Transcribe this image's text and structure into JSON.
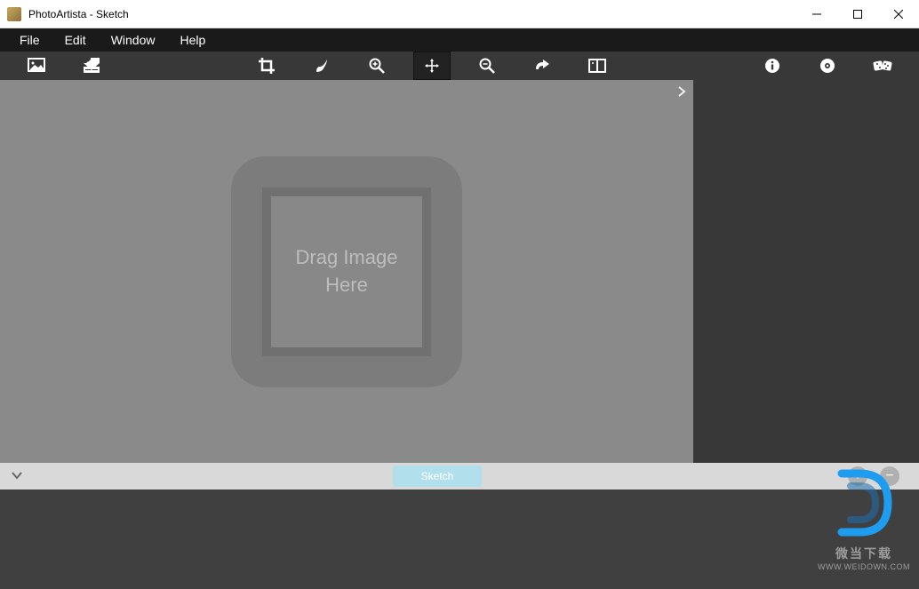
{
  "window": {
    "title": "PhotoArtista - Sketch"
  },
  "menu": {
    "file": "File",
    "edit": "Edit",
    "window": "Window",
    "help": "Help"
  },
  "toolbar": {
    "open": "open-image",
    "save": "save-image",
    "crop": "crop",
    "brush": "brush",
    "zoom_in": "zoom-in",
    "pan": "pan",
    "zoom_out": "zoom-out",
    "redo": "redo",
    "compare": "compare",
    "info": "info",
    "settings": "settings",
    "random": "random"
  },
  "canvas": {
    "drop_text": "Drag Image Here"
  },
  "presets": {
    "tab": "Sketch",
    "add": "+",
    "remove": "−"
  },
  "watermark": {
    "cn": "微当下载",
    "url": "WWW.WEIDOWN.COM"
  }
}
